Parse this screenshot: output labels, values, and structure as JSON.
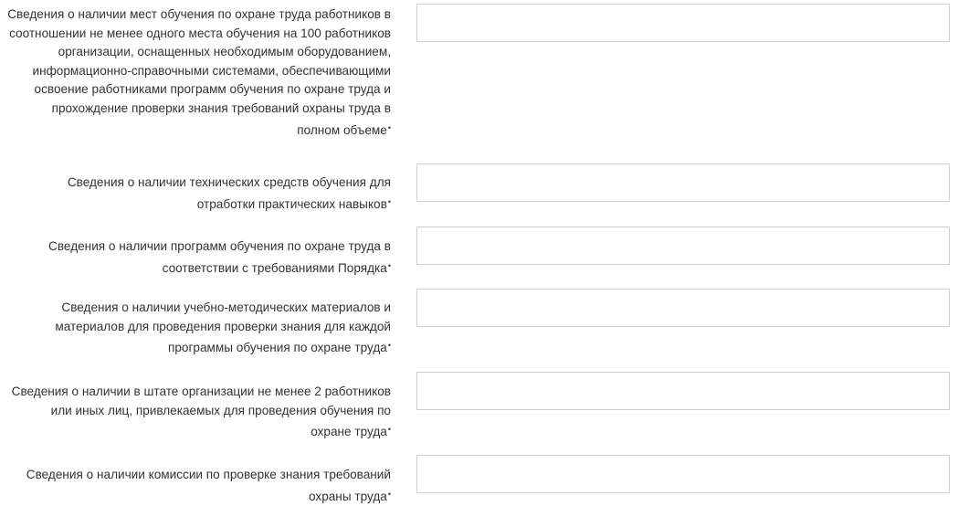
{
  "fields": [
    {
      "label": "Сведения о наличии мест обучения по охране труда работников в соотношении не менее одного места обучения на 100 работников организации, оснащенных необходимым оборудованием, информационно-справочными системами, обеспечивающими освоение работниками программ обучения по охране труда и прохождение проверки знания требований охраны труда в полном объеме",
      "required_mark": "•",
      "value": ""
    },
    {
      "label": "Сведения о наличии технических средств обучения для отработки практических навыков",
      "required_mark": "•",
      "value": ""
    },
    {
      "label": "Сведения о наличии программ обучения по охране труда в соответствии с требованиями Порядка",
      "required_mark": "•",
      "value": ""
    },
    {
      "label": "Сведения о наличии учебно-методических материалов и материалов для проведения проверки знания для каждой программы обучения по охране труда",
      "required_mark": "•",
      "value": ""
    },
    {
      "label": "Сведения о наличии в штате организации не менее 2 работников или иных лиц, привлекаемых для проведения обучения по охране труда",
      "required_mark": "•",
      "value": ""
    },
    {
      "label": "Сведения о наличии комиссии по проверке знания требований охраны труда",
      "required_mark": "•",
      "value": ""
    }
  ]
}
